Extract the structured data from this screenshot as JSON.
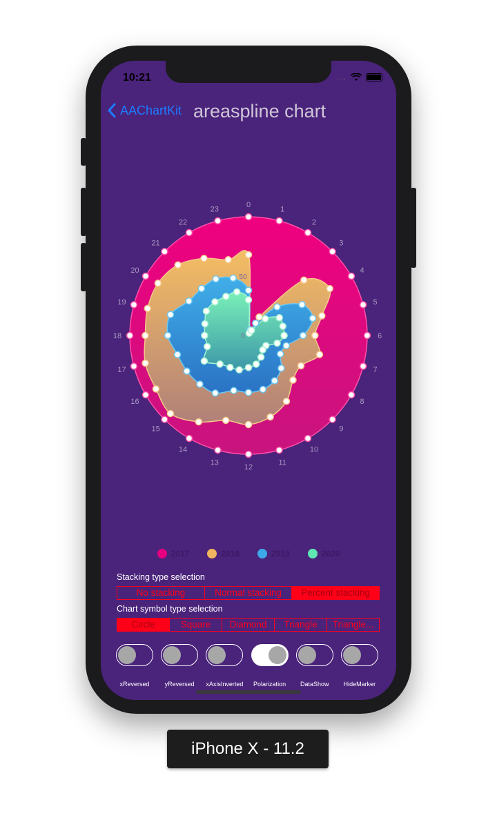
{
  "status_bar": {
    "time": "10:21",
    "signal": "....",
    "wifi_icon": "wifi-icon",
    "battery_icon": "battery-icon"
  },
  "nav": {
    "back_label": "AAChartKit",
    "title": "areaspline chart",
    "back_icon": "chevron-left-icon"
  },
  "chart_data": {
    "type": "area",
    "title": "",
    "polar": true,
    "stacking": "percent",
    "categories": [
      "0",
      "1",
      "2",
      "3",
      "4",
      "5",
      "6",
      "7",
      "8",
      "9",
      "10",
      "11",
      "12",
      "13",
      "14",
      "15",
      "16",
      "17",
      "18",
      "19",
      "20",
      "21",
      "22",
      "23"
    ],
    "radial_tick_labels": [
      "0",
      "50"
    ],
    "series": [
      {
        "name": "2017",
        "color": "#e4007f",
        "values": [
          100,
          100,
          100,
          100,
          100,
          100,
          100,
          100,
          100,
          100,
          100,
          100,
          100,
          100,
          100,
          100,
          100,
          100,
          100,
          100,
          100,
          100,
          100,
          100
        ]
      },
      {
        "name": "2018",
        "color": "#f0b55f",
        "values": [
          68,
          5,
          18,
          66,
          79,
          64,
          56,
          62,
          51,
          53,
          64,
          71,
          75,
          74,
          84,
          93,
          90,
          90,
          87,
          88,
          88,
          84,
          75,
          66
        ]
      },
      {
        "name": "2019",
        "color": "#3da9e8",
        "values": [
          38,
          5,
          12,
          34,
          52,
          56,
          46,
          33,
          31,
          39,
          44,
          47,
          48,
          48,
          56,
          58,
          60,
          62,
          68,
          68,
          58,
          56,
          55,
          50
        ]
      },
      {
        "name": "2020",
        "color": "#5ee7b2",
        "values": [
          30,
          2,
          5,
          20,
          30,
          30,
          30,
          25,
          17,
          17,
          21,
          25,
          27,
          30,
          31,
          34,
          43,
          36,
          37,
          38,
          41,
          40,
          38,
          38
        ]
      }
    ]
  },
  "legend": [
    {
      "label": "2017",
      "color": "#e4007f"
    },
    {
      "label": "2018",
      "color": "#f0b55f"
    },
    {
      "label": "2019",
      "color": "#3da9e8"
    },
    {
      "label": "2020",
      "color": "#5ee7b2"
    }
  ],
  "stacking": {
    "label": "Stacking type selection",
    "options": [
      "No stacking",
      "Normal stacking",
      "Percent stacking"
    ],
    "selected_index": 2
  },
  "symbol": {
    "label": "Chart symbol type selection",
    "options": [
      "Circle",
      "Square",
      "Diamond",
      "Triangle",
      "Triangle..."
    ],
    "selected_index": 0
  },
  "switches": [
    {
      "label": "xReversed",
      "on": false
    },
    {
      "label": "yReversed",
      "on": false
    },
    {
      "label": "xAxisInverted",
      "on": false
    },
    {
      "label": "Polarization",
      "on": true
    },
    {
      "label": "DataShow",
      "on": false
    },
    {
      "label": "HideMarker",
      "on": false
    }
  ],
  "device_label": "iPhone X - 11.2"
}
